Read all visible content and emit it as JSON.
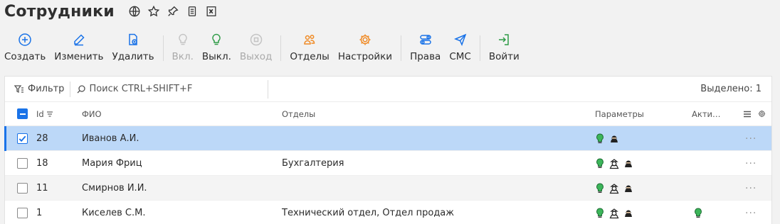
{
  "title": "Сотрудники",
  "title_icons": [
    "globe-icon",
    "star-icon",
    "pin-icon",
    "scroll-icon",
    "excel-icon"
  ],
  "toolbar": {
    "items": [
      {
        "label": "Создать",
        "icon": "plus-circle-icon",
        "disabled": false
      },
      {
        "label": "Изменить",
        "icon": "pencil-icon",
        "disabled": false
      },
      {
        "label": "Удалить",
        "icon": "delete-document-icon",
        "disabled": false
      },
      {
        "label": "Вкл.",
        "icon": "bulb-icon",
        "disabled": true
      },
      {
        "label": "Выкл.",
        "icon": "bulb-icon",
        "disabled": false
      },
      {
        "label": "Выход",
        "icon": "exit-icon",
        "disabled": true
      },
      {
        "label": "Отделы",
        "icon": "people-icon",
        "disabled": false
      },
      {
        "label": "Настройки",
        "icon": "gear-icon",
        "disabled": false
      },
      {
        "label": "Права",
        "icon": "toggles-icon",
        "disabled": false
      },
      {
        "label": "СМС",
        "icon": "send-icon",
        "disabled": false
      },
      {
        "label": "Войти",
        "icon": "login-icon",
        "disabled": false
      }
    ]
  },
  "filter": {
    "label": "Фильтр",
    "search_placeholder": "Поиск CTRL+SHIFT+F",
    "selected_label": "Выделено: 1"
  },
  "table": {
    "columns": {
      "id": "Id",
      "name": "ФИО",
      "departments": "Отделы",
      "params": "Параметры",
      "active": "Акти…"
    },
    "rows": [
      {
        "id": "28",
        "name": "Иванов А.И.",
        "departments": "",
        "selected": true,
        "params": [
          "bulb-green-icon",
          "ninja-icon"
        ],
        "active": false
      },
      {
        "id": "18",
        "name": "Мария Фриц",
        "departments": "Бухгалтерия",
        "selected": false,
        "params": [
          "bulb-green-icon",
          "spy-icon",
          "ninja-icon"
        ],
        "active": false
      },
      {
        "id": "11",
        "name": "Смирнов И.И.",
        "departments": "",
        "selected": false,
        "params": [
          "bulb-green-icon",
          "spy-icon",
          "ninja-icon"
        ],
        "active": false
      },
      {
        "id": "1",
        "name": "Киселев С.М.",
        "departments": "Технический отдел, Отдел продаж",
        "selected": false,
        "params": [
          "bulb-green-icon",
          "spy-icon",
          "ninja-icon"
        ],
        "active": true
      }
    ],
    "more_label": "···"
  },
  "colors": {
    "accent": "#1a73e8",
    "orange": "#f08a24",
    "green": "#2e9b46",
    "selected_row": "#bcd8f8"
  }
}
